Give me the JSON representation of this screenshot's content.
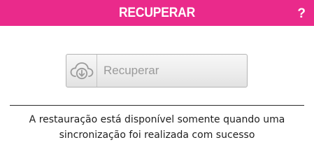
{
  "header": {
    "title": "RECUPERAR",
    "help_label": "?",
    "background_color": "#ea2a8b"
  },
  "restore_button": {
    "label": "Recuperar",
    "icon": "cloud-download-icon"
  },
  "info": {
    "line1": "A restauração está disponível somente quando uma",
    "line2": "sincronização foi realizada com sucesso"
  }
}
